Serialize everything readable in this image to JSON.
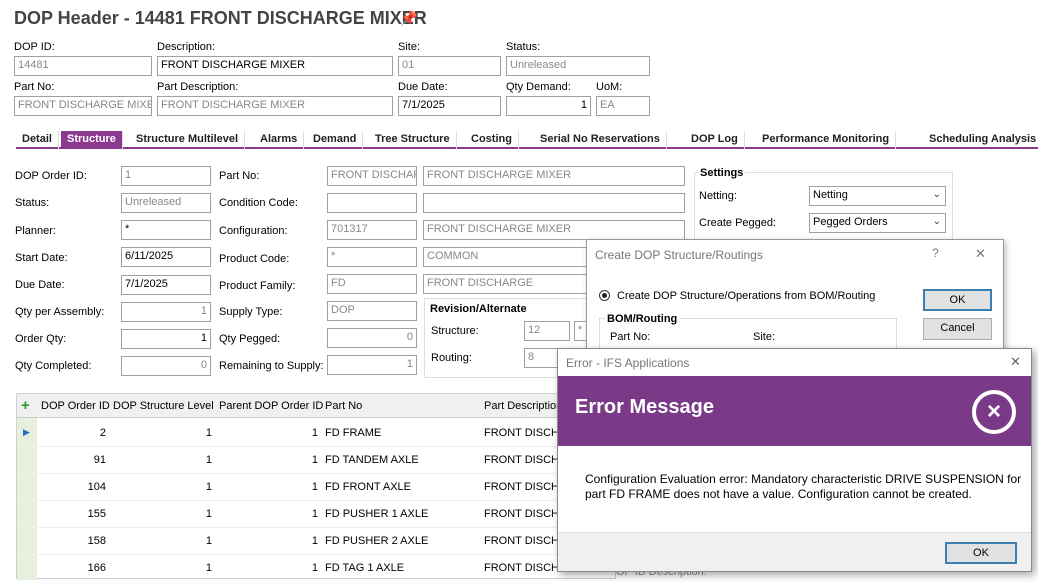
{
  "header": {
    "title": "DOP Header - 14481 FRONT DISCHARGE MIXER",
    "fields": {
      "dop_id_label": "DOP ID:",
      "dop_id": "14481",
      "description_label": "Description:",
      "description": "FRONT DISCHARGE MIXER",
      "site_label": "Site:",
      "site": "01",
      "status_label": "Status:",
      "status": "Unreleased",
      "part_no_label": "Part No:",
      "part_no": "FRONT DISCHARGE MIXER",
      "part_desc_label": "Part Description:",
      "part_desc": "FRONT DISCHARGE MIXER",
      "due_date_label": "Due Date:",
      "due_date": "7/1/2025",
      "qty_demand_label": "Qty Demand:",
      "qty_demand": "1",
      "uom_label": "UoM:",
      "uom": "EA"
    }
  },
  "tabs": [
    "Detail",
    "Structure",
    "Structure Multilevel",
    "Alarms",
    "Demand",
    "Tree Structure",
    "Costing",
    "Serial No Reservations",
    "DOP Log",
    "Performance Monitoring",
    "Scheduling Analysis"
  ],
  "active_tab": "Structure",
  "form": {
    "dop_order_id_label": "DOP Order ID:",
    "dop_order_id": "1",
    "status_label": "Status:",
    "status": "Unreleased",
    "planner_label": "Planner:",
    "planner": "*",
    "start_date_label": "Start Date:",
    "start_date": "6/11/2025",
    "due_date_label": "Due Date:",
    "due_date": "7/1/2025",
    "qty_per_assembly_label": "Qty per Assembly:",
    "qty_per_assembly": "1",
    "order_qty_label": "Order Qty:",
    "order_qty": "1",
    "qty_completed_label": "Qty Completed:",
    "qty_completed": "0",
    "part_no_label": "Part No:",
    "part_no": "FRONT DISCHARG",
    "part_no_desc": "FRONT DISCHARGE MIXER",
    "condition_code_label": "Condition Code:",
    "configuration_label": "Configuration:",
    "configuration": "701317",
    "configuration_desc": "FRONT DISCHARGE MIXER",
    "product_code_label": "Product Code:",
    "product_code": "*",
    "product_code_desc": "COMMON",
    "product_family_label": "Product Family:",
    "product_family": "FD",
    "product_family_desc": "FRONT DISCHARGE",
    "supply_type_label": "Supply Type:",
    "supply_type": "DOP",
    "qty_pegged_label": "Qty Pegged:",
    "qty_pegged": "0",
    "remaining_label": "Remaining to Supply:",
    "remaining": "1",
    "revision_title": "Revision/Alternate",
    "structure_label": "Structure:",
    "structure": "12",
    "routing_label": "Routing:",
    "routing": "8",
    "settings_title": "Settings",
    "netting_label": "Netting:",
    "netting": "Netting",
    "create_pegged_label": "Create Pegged:",
    "create_pegged": "Pegged Orders"
  },
  "grid": {
    "columns": [
      "DOP Order ID",
      "DOP Structure Level",
      "Parent DOP Order ID",
      "Part No",
      "Part Description"
    ],
    "rows": [
      [
        "2",
        "1",
        "1",
        "FD FRAME",
        "FRONT DISCHA"
      ],
      [
        "91",
        "1",
        "1",
        "FD TANDEM AXLE",
        "FRONT DISCHA"
      ],
      [
        "104",
        "1",
        "1",
        "FD FRONT AXLE",
        "FRONT DISCHA"
      ],
      [
        "155",
        "1",
        "1",
        "FD PUSHER 1 AXLE",
        "FRONT DISCHA"
      ],
      [
        "158",
        "1",
        "1",
        "FD PUSHER 2 AXLE",
        "FRONT DISCHA"
      ],
      [
        "166",
        "1",
        "1",
        "FD TAG 1 AXLE",
        "FRONT DISCHA"
      ]
    ]
  },
  "create_dialog": {
    "title": "Create DOP Structure/Routings",
    "help": "?",
    "close": "✕",
    "option": "Create DOP Structure/Operations from BOM/Routing",
    "group_title": "BOM/Routing",
    "part_no_label": "Part No:",
    "site_label": "Site:",
    "ok": "OK",
    "cancel": "Cancel",
    "bottom_label": "DOP ID Description:"
  },
  "error_dialog": {
    "title": "Error - IFS Applications",
    "close": "✕",
    "heading": "Error Message",
    "message": "Configuration Evaluation error:  Mandatory characteristic DRIVE SUSPENSION for part FD FRAME does not have a value. Configuration cannot be created.",
    "ok": "OK",
    "accent": "#7b3a87"
  }
}
